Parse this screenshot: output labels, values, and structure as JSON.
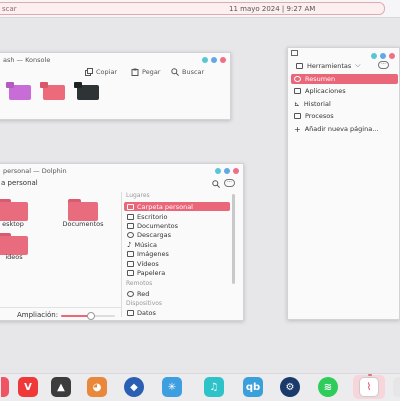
{
  "topbar": {
    "search_placeholder": "scar",
    "clock": "11 mayo 2024 | 9:27 AM"
  },
  "konsole": {
    "title": "ash — Konsole",
    "toolbar": {
      "copy": "Copiar",
      "paste": "Pegar",
      "search": "Buscar"
    },
    "tile_colors": [
      "#c86dd7",
      "#ec6a7a",
      "#2e3436"
    ]
  },
  "dolphin": {
    "title": "personal — Dolphin",
    "breadcrumb": "a personal",
    "folders": [
      "esktop",
      "Documentos",
      "ideos"
    ],
    "zoom_label": "Ampliación:",
    "zoom_level": 0.55,
    "places": {
      "section_places": "Lugares",
      "items": [
        "Carpeta personal",
        "Escritorio",
        "Documentos",
        "Descargas",
        "Música",
        "Imágenes",
        "Vídeos",
        "Papelera"
      ],
      "section_remote": "Remotos",
      "remote": [
        "Red"
      ],
      "section_devices": "Dispositivos",
      "devices": [
        "Datos"
      ]
    }
  },
  "panel": {
    "toolbar_label": "Herramientas",
    "items": [
      "Resumen",
      "Aplicaciones",
      "Historial",
      "Procesos",
      "Añadir nueva página..."
    ]
  },
  "colors": {
    "accent": "#ea6679",
    "dot_teal": "#58c7d4",
    "dot_blue": "#61a8e6",
    "dot_pink": "#ee6f86"
  },
  "dock": {
    "apps": [
      "vivaldi",
      "inkscape",
      "grub-customizer",
      "plasma-discover",
      "kdeconnect",
      "music",
      "qbittorrent",
      "steam",
      "spotify",
      "system-monitor"
    ]
  }
}
